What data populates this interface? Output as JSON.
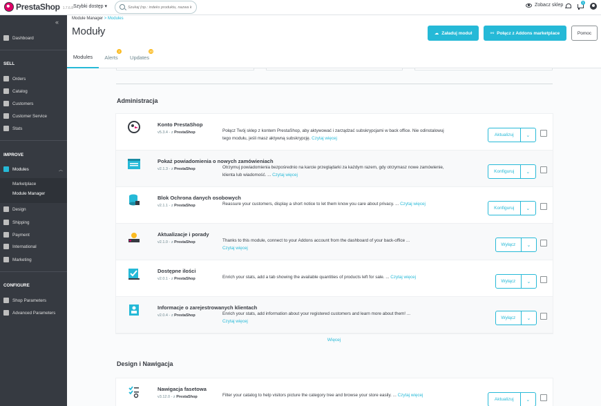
{
  "topbar": {
    "logo_text": "PrestaShop",
    "version": "1.7.6.8",
    "quick_access": "Szybki dostęp",
    "search_placeholder": "Szukaj (np.: indeks produktu, nazwa k",
    "view_shop": "Zobacz sklep",
    "cart_badge": "1"
  },
  "sidebar": {
    "dashboard": "Dashboard",
    "sell_header": "SELL",
    "orders": "Orders",
    "catalog": "Catalog",
    "customers": "Customers",
    "customer_service": "Customer Service",
    "stats": "Stats",
    "improve_header": "IMPROVE",
    "modules": "Modules",
    "marketplace": "Marketplace",
    "module_manager": "Module Manager",
    "design": "Design",
    "shipping": "Shipping",
    "payment": "Payment",
    "international": "International",
    "marketing": "Marketing",
    "configure_header": "CONFIGURE",
    "shop_parameters": "Shop Parameters",
    "advanced_parameters": "Advanced Parameters"
  },
  "header": {
    "breadcrumb_parent": "Module Manager",
    "breadcrumb_sep": ">",
    "breadcrumb_current": "Modules",
    "title": "Moduły",
    "upload_button": "Załaduj moduł",
    "connect_button": "Połącz z Addons marketplace",
    "help_button": "Pomoc",
    "tabs": [
      {
        "label": "Modules"
      },
      {
        "label": "Alerts",
        "badge": "2"
      },
      {
        "label": "Updates",
        "badge": "10"
      }
    ]
  },
  "sections": [
    {
      "title": "Administracja",
      "modules": [
        {
          "name": "Konto PrestaShop",
          "version": "v5.3.4 - z",
          "author": "PrestaShop",
          "desc": "Połącz Twój sklep z kontem PrestaShop, aby aktywować i zarządzać subskrypcjami w back office. Nie odinstalowuj tego modułu, jeśli masz aktywną subskrypcję.",
          "more": "Czytaj więcej",
          "action": "Aktualizuj",
          "icon": "prestashop-puffin-icon"
        },
        {
          "name": "Pokaż powiadomienia o nowych zamówieniach",
          "version": "v2.1.3 - z",
          "author": "PrestaShop",
          "desc": "Otrzymuj powiadomienia bezpośrednio na karcie przeglądarki za każdym razem, gdy otrzymasz nowe zamówienie, klienta lub wiadomość. ...",
          "more": "Czytaj więcej",
          "action": "Konfiguruj",
          "icon": "browser-notification-icon"
        },
        {
          "name": "Blok Ochrona danych osobowych",
          "version": "v2.1.1 - z",
          "author": "PrestaShop",
          "desc": "Reassure your customers, display a short notice to let them know you care about privacy. ...",
          "more": "Czytaj więcej",
          "action": "Konfiguruj",
          "icon": "database-lock-icon"
        },
        {
          "name": "Aktualizacje i porady",
          "version": "v2.1.0 - z",
          "author": "PrestaShop",
          "desc": "Thanks to this module, connect to your Addons account from the dashboard of your back-office ...",
          "more": "Czytaj więcej",
          "action": "Wyłącz",
          "icon": "tips-updates-icon"
        },
        {
          "name": "Dostępne ilości",
          "version": "v2.0.1 - z",
          "author": "PrestaShop",
          "desc": "Enrich your stats, add a tab showing the available quantities of products left for sale. ...",
          "more": "Czytaj więcej",
          "action": "Wyłącz",
          "icon": "stock-checklist-icon"
        },
        {
          "name": "Informacje o zarejestrowanych klientach",
          "version": "v2.0.4 - z",
          "author": "PrestaShop",
          "desc": "Enrich your stats, add information about your registered customers and learn more about them! ...",
          "more": "Czytaj więcej",
          "action": "Wyłącz",
          "icon": "customer-card-icon"
        }
      ],
      "more_link": "Więcej"
    },
    {
      "title": "Design i Nawigacja",
      "modules": [
        {
          "name": "Nawigacja fasetowa",
          "version": "v3.12.0 - z",
          "author": "PrestaShop",
          "desc": "Filter your catalog to help visitors picture the category tree and browse your store easily. ...",
          "more": "Czytaj więcej",
          "action": "Aktualizuj",
          "icon": "faceted-search-icon"
        }
      ]
    }
  ],
  "colors": {
    "accent": "#25b9d7",
    "sidebar": "#363a41",
    "badge": "#fbbb22"
  }
}
